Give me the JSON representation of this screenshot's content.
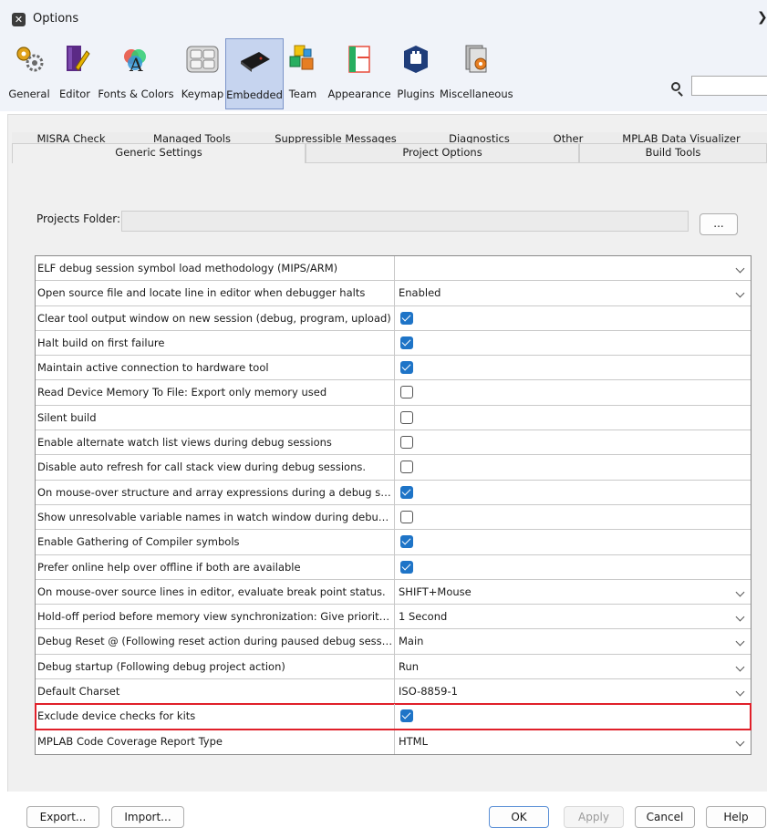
{
  "window": {
    "title": "Options",
    "close_glyph": "❯"
  },
  "categories": [
    {
      "label": "General",
      "icon": "gears-icon",
      "active": false
    },
    {
      "label": "Editor",
      "icon": "editor-icon",
      "active": false
    },
    {
      "label": "Fonts & Colors",
      "icon": "fonts-colors-icon",
      "active": false
    },
    {
      "label": "Keymap",
      "icon": "keymap-icon",
      "active": false
    },
    {
      "label": "Embedded",
      "icon": "embedded-chip-icon",
      "active": true
    },
    {
      "label": "Team",
      "icon": "team-icon",
      "active": false
    },
    {
      "label": "Appearance",
      "icon": "appearance-icon",
      "active": false
    },
    {
      "label": "Plugins",
      "icon": "plugins-icon",
      "active": false
    },
    {
      "label": "Miscellaneous",
      "icon": "miscellaneous-icon",
      "active": false
    }
  ],
  "search": {
    "value": ""
  },
  "tabs_row1": [
    "MISRA Check",
    "Managed Tools",
    "Suppressible Messages",
    "Diagnostics",
    "Other",
    "MPLAB Data Visualizer"
  ],
  "tabs_row2": [
    {
      "label": "Generic Settings",
      "active": true
    },
    {
      "label": "Project Options",
      "active": false
    },
    {
      "label": "Build Tools",
      "active": false
    }
  ],
  "projects_folder": {
    "label": "Projects Folder:",
    "value": "",
    "browse_label": "..."
  },
  "settings": [
    {
      "label": "ELF debug session symbol load methodology (MIPS/ARM)",
      "type": "select",
      "value": ""
    },
    {
      "label": "Open source file and locate line in editor when debugger halts",
      "type": "select",
      "value": "Enabled"
    },
    {
      "label": "Clear tool output window on new session (debug, program, upload)",
      "type": "checkbox",
      "checked": true
    },
    {
      "label": "Halt build on first failure",
      "type": "checkbox",
      "checked": true
    },
    {
      "label": "Maintain active connection to hardware tool",
      "type": "checkbox",
      "checked": true
    },
    {
      "label": "Read Device Memory To File: Export only memory used",
      "type": "checkbox",
      "checked": false
    },
    {
      "label": "Silent build",
      "type": "checkbox",
      "checked": false
    },
    {
      "label": "Enable alternate watch list views during debug sessions",
      "type": "checkbox",
      "checked": false
    },
    {
      "label": "Disable auto refresh for call stack view during debug sessions.",
      "type": "checkbox",
      "checked": false
    },
    {
      "label": "On mouse-over structure and array expressions during a debug sess…",
      "type": "checkbox",
      "checked": true
    },
    {
      "label": "Show unresolvable variable names in watch window during debug se…",
      "type": "checkbox",
      "checked": false
    },
    {
      "label": "Enable Gathering of Compiler symbols",
      "type": "checkbox",
      "checked": true
    },
    {
      "label": "Prefer online help over offline if both are available",
      "type": "checkbox",
      "checked": true
    },
    {
      "label": "On mouse-over source lines in editor, evaluate break point status.",
      "type": "select",
      "value": "SHIFT+Mouse"
    },
    {
      "label": "Hold-off period before memory view synchronization: Give priority to…",
      "type": "select",
      "value": "1 Second"
    },
    {
      "label": "Debug Reset @    (Following reset action during paused debug session)",
      "type": "select",
      "value": "Main"
    },
    {
      "label": "Debug startup    (Following debug project action)",
      "type": "select",
      "value": "Run"
    },
    {
      "label": "Default Charset",
      "type": "select",
      "value": "ISO-8859-1"
    },
    {
      "label": "Exclude device checks for kits",
      "type": "checkbox",
      "checked": true,
      "highlighted": true
    },
    {
      "label": "MPLAB Code Coverage Report Type",
      "type": "select",
      "value": "HTML"
    }
  ],
  "buttons": {
    "export": "Export...",
    "import": "Import...",
    "ok": "OK",
    "apply": "Apply",
    "cancel": "Cancel",
    "help": "Help"
  },
  "colors": {
    "accent": "#1e74c7",
    "highlight": "#e0202a",
    "active_category": "#c6d4ef"
  }
}
